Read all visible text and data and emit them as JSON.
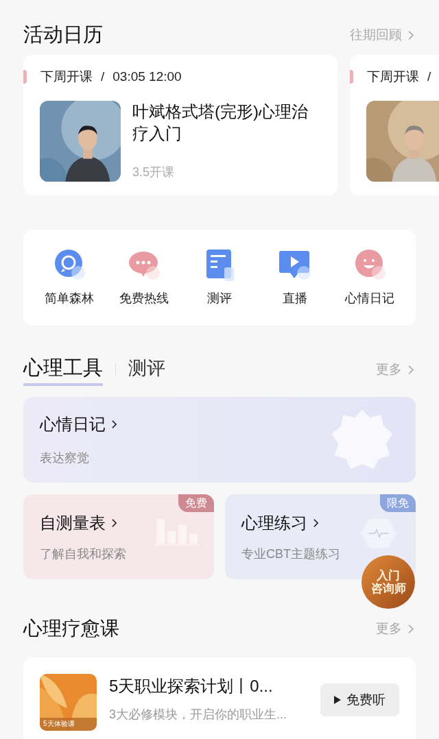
{
  "calendar": {
    "title": "活动日历",
    "link": "往期回顾",
    "events": [
      {
        "tag": "下周开课",
        "separator": "/",
        "time": "03:05 12:00",
        "title": "叶斌格式塔(完形)心理治疗入门",
        "note": "3.5开课"
      },
      {
        "tag": "下周开课",
        "separator": "/"
      }
    ]
  },
  "shortcuts": [
    {
      "label": "简单森林",
      "kind": "chat"
    },
    {
      "label": "免费热线",
      "kind": "bubble"
    },
    {
      "label": "测评",
      "kind": "doc"
    },
    {
      "label": "直播",
      "kind": "play"
    },
    {
      "label": "心情日记",
      "kind": "smile"
    }
  ],
  "tools": {
    "tabs": [
      {
        "label": "心理工具",
        "selected": true
      },
      {
        "label": "测评",
        "selected": false
      }
    ],
    "link": "更多",
    "featured": {
      "title": "心情日记",
      "subtitle": "表达察觉"
    },
    "cards": [
      {
        "title": "自测量表",
        "subtitle": "了解自我和探索",
        "badge": "免费",
        "kind": "chart"
      },
      {
        "title": "心理练习",
        "subtitle": "专业CBT主题练习",
        "badge": "限免",
        "kind": "pulse"
      }
    ]
  },
  "floating_badge": {
    "lines": [
      "入门",
      "咨询师"
    ]
  },
  "courses": {
    "title": "心理疗愈课",
    "link": "更多",
    "items": [
      {
        "title": "5天职业探索计划丨0...",
        "subtitle": "3大必修模块，开启你的职业生...",
        "cover_label": "5天体验课",
        "action": "免费听"
      }
    ]
  }
}
